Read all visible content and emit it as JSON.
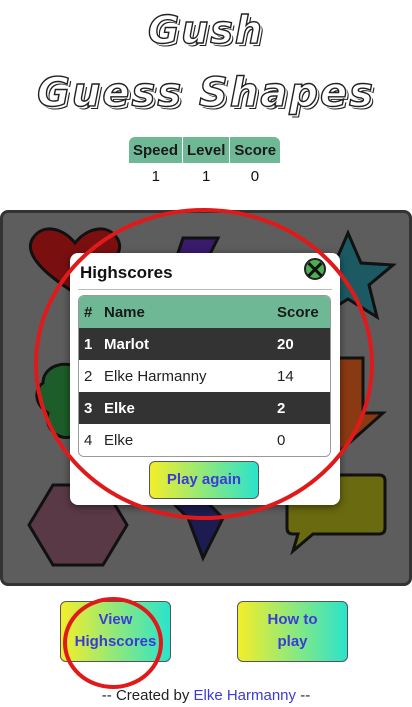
{
  "header": {
    "title_line1": "Gush",
    "title_line2": "Guess Shapes"
  },
  "stats": {
    "headers": [
      "Speed",
      "Level",
      "Score"
    ],
    "values": [
      "1",
      "1",
      "0"
    ]
  },
  "highscores": {
    "title": "Highscores",
    "columns": [
      "#",
      "Name",
      "Score"
    ],
    "rows": [
      {
        "rank": "1",
        "name": "Marlot",
        "score": "20"
      },
      {
        "rank": "2",
        "name": "Elke Harmanny",
        "score": "14"
      },
      {
        "rank": "3",
        "name": "Elke",
        "score": "2"
      },
      {
        "rank": "4",
        "name": "Elke",
        "score": "0"
      }
    ],
    "play_again": "Play again"
  },
  "buttons": {
    "view_line1": "View",
    "view_line2": "Highscores",
    "how_line1": "How to",
    "how_line2": "play"
  },
  "footer": {
    "prefix": "-- Created by ",
    "author": "Elke Harmanny",
    "suffix": " --"
  },
  "colors": {
    "accent_green": "#6fb896",
    "link_blue": "#3b3bd6",
    "annotation_red": "#e01a1a"
  },
  "board_shapes": [
    "heart",
    "lightning",
    "star",
    "blob",
    "arrow",
    "hexagon",
    "diamond",
    "speech-bubble"
  ]
}
